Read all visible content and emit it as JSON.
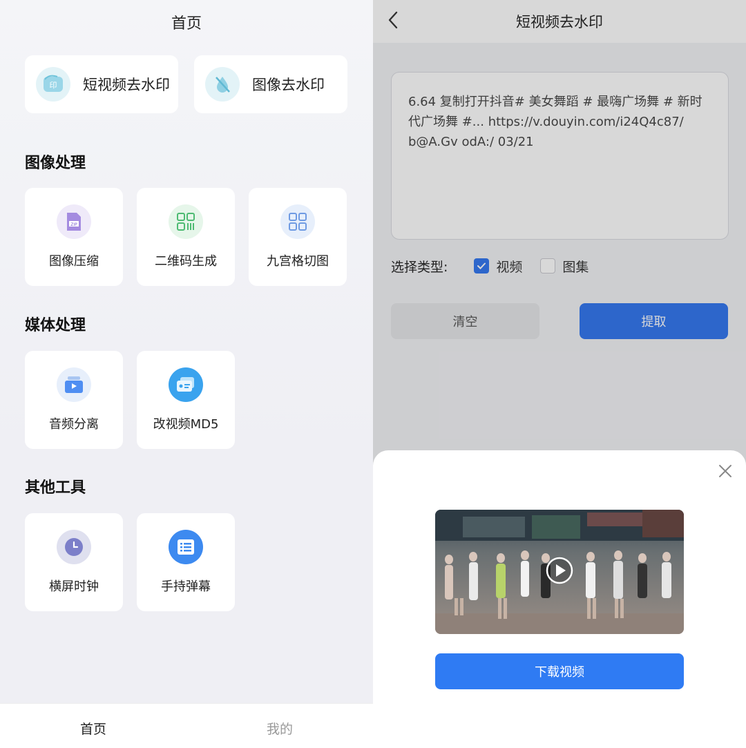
{
  "home": {
    "title": "首页",
    "quick_actions": [
      {
        "label": "短视频去水印",
        "icon": "video-watermark-icon"
      },
      {
        "label": "图像去水印",
        "icon": "image-watermark-icon"
      }
    ],
    "sections": [
      {
        "title": "图像处理",
        "items": [
          {
            "label": "图像压缩",
            "icon": "zip-file-icon"
          },
          {
            "label": "二维码生成",
            "icon": "qr-code-icon"
          },
          {
            "label": "九宫格切图",
            "icon": "grid-icon"
          }
        ]
      },
      {
        "title": "媒体处理",
        "items": [
          {
            "label": "音频分离",
            "icon": "audio-split-icon"
          },
          {
            "label": "改视频MD5",
            "icon": "video-md5-icon"
          }
        ]
      },
      {
        "title": "其他工具",
        "items": [
          {
            "label": "横屏时钟",
            "icon": "clock-icon"
          },
          {
            "label": "手持弹幕",
            "icon": "danmaku-icon"
          }
        ]
      }
    ],
    "tabbar": {
      "home": "首页",
      "mine": "我的"
    }
  },
  "extract": {
    "title": "短视频去水印",
    "input_text": "6.64 复制打开抖音# 美女舞蹈 # 最嗨广场舞 # 新时代广场舞 #... https://v.douyin.com/i24Q4c87/ b@A.Gv odA:/ 03/21",
    "type_label": "选择类型:",
    "options": [
      {
        "label": "视频",
        "checked": true
      },
      {
        "label": "图集",
        "checked": false
      }
    ],
    "clear_label": "清空",
    "extract_label": "提取",
    "download_label": "下载视频"
  },
  "colors": {
    "primary": "#2f74f0",
    "page_bg": "#f2f3f6"
  }
}
